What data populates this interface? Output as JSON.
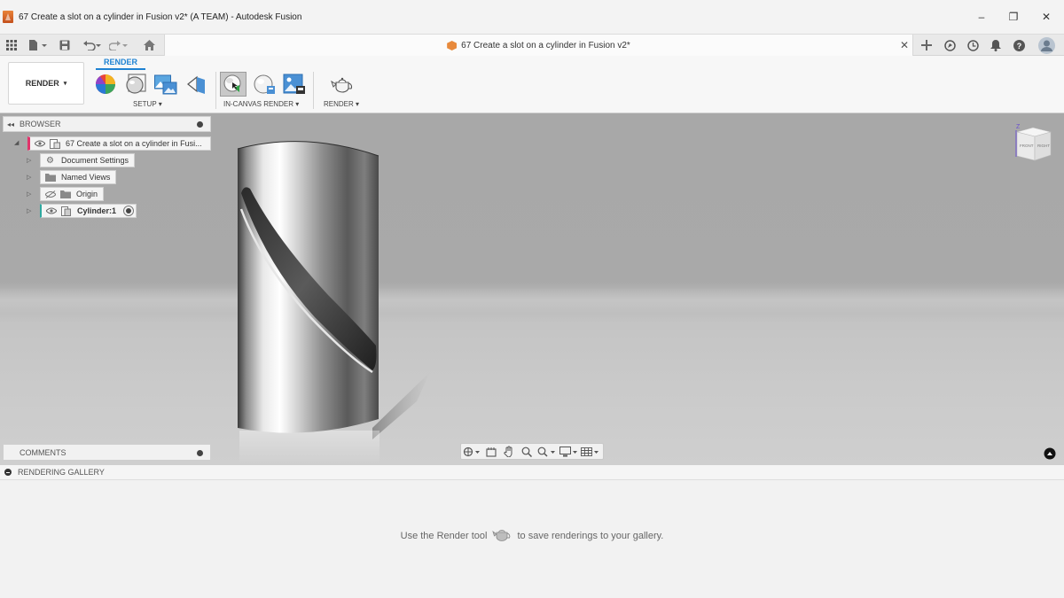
{
  "window": {
    "title": "67 Create a slot on a cylinder in Fusion v2* (A TEAM) - Autodesk Fusion",
    "minimize": "–",
    "maximize": "❐",
    "close": "✕"
  },
  "document_tab": {
    "title": "67 Create a slot on a cylinder in Fusion v2*",
    "close": "✕"
  },
  "ribbon": {
    "workspace": "RENDER",
    "workspace_caret": "▾",
    "active_tab": "RENDER",
    "groups": {
      "setup": "SETUP ▾",
      "in_canvas": "IN-CANVAS RENDER ▾",
      "render": "RENDER ▾"
    }
  },
  "browser": {
    "collapse": "◂◂",
    "title": "BROWSER",
    "items": [
      {
        "label": "67 Create a slot on a cylinder in Fusi..."
      },
      {
        "label": "Document Settings"
      },
      {
        "label": "Named Views"
      },
      {
        "label": "Origin"
      },
      {
        "label": "Cylinder:1"
      }
    ]
  },
  "viewcube": {
    "front": "FRONT",
    "right": "RIGHT",
    "axis": "Z"
  },
  "comments": {
    "title": "COMMENTS"
  },
  "gallery": {
    "title": "RENDERING GALLERY",
    "message_before": "Use the Render tool",
    "message_after": "to save renderings to your gallery."
  },
  "colors": {
    "accent": "#1e82d2",
    "viewport_bg": "#a9a9a9",
    "doc_icon": "#e88a3c"
  }
}
